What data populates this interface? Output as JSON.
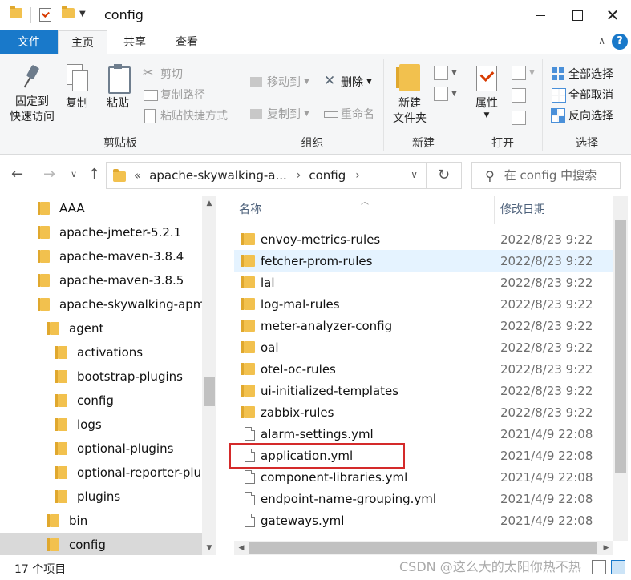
{
  "title": "config",
  "ribbon_tabs": [
    "文件",
    "主页",
    "共享",
    "查看"
  ],
  "ribbon": {
    "clipboard": {
      "label": "剪贴板",
      "pin": "固定到快速访问",
      "pin_l1": "固定到",
      "pin_l2": "快速访问",
      "copy": "复制",
      "paste": "粘贴",
      "cut": "剪切",
      "copy_path": "复制路径",
      "paste_shortcut": "粘贴快捷方式"
    },
    "organize": {
      "label": "组织",
      "move_to": "移动到",
      "copy_to": "复制到",
      "delete": "删除",
      "rename": "重命名"
    },
    "new": {
      "label": "新建",
      "new_folder_l1": "新建",
      "new_folder_l2": "文件夹"
    },
    "open": {
      "label": "打开",
      "properties": "属性"
    },
    "select": {
      "label": "选择",
      "select_all": "全部选择",
      "select_none": "全部取消",
      "invert": "反向选择"
    }
  },
  "address": {
    "overflow": "«",
    "segments": [
      "apache-skywalking-a...",
      "config"
    ],
    "search_placeholder": "在 config 中搜索"
  },
  "tree": [
    {
      "label": "AAA"
    },
    {
      "label": "apache-jmeter-5.2.1"
    },
    {
      "label": "apache-maven-3.8.4"
    },
    {
      "label": "apache-maven-3.8.5"
    },
    {
      "label": "apache-skywalking-apm"
    },
    {
      "label": "agent"
    },
    {
      "label": "activations"
    },
    {
      "label": "bootstrap-plugins"
    },
    {
      "label": "config"
    },
    {
      "label": "logs"
    },
    {
      "label": "optional-plugins"
    },
    {
      "label": "optional-reporter-plu"
    },
    {
      "label": "plugins"
    },
    {
      "label": "bin"
    },
    {
      "label": "config"
    }
  ],
  "columns": {
    "name": "名称",
    "date": "修改日期"
  },
  "files": [
    {
      "name": "envoy-metrics-rules",
      "date": "2022/8/23 9:22",
      "type": "folder"
    },
    {
      "name": "fetcher-prom-rules",
      "date": "2022/8/23 9:22",
      "type": "folder"
    },
    {
      "name": "lal",
      "date": "2022/8/23 9:22",
      "type": "folder"
    },
    {
      "name": "log-mal-rules",
      "date": "2022/8/23 9:22",
      "type": "folder"
    },
    {
      "name": "meter-analyzer-config",
      "date": "2022/8/23 9:22",
      "type": "folder"
    },
    {
      "name": "oal",
      "date": "2022/8/23 9:22",
      "type": "folder"
    },
    {
      "name": "otel-oc-rules",
      "date": "2022/8/23 9:22",
      "type": "folder"
    },
    {
      "name": "ui-initialized-templates",
      "date": "2022/8/23 9:22",
      "type": "folder"
    },
    {
      "name": "zabbix-rules",
      "date": "2022/8/23 9:22",
      "type": "folder"
    },
    {
      "name": "alarm-settings.yml",
      "date": "2021/4/9 22:08",
      "type": "file"
    },
    {
      "name": "application.yml",
      "date": "2021/4/9 22:08",
      "type": "file"
    },
    {
      "name": "component-libraries.yml",
      "date": "2021/4/9 22:08",
      "type": "file"
    },
    {
      "name": "endpoint-name-grouping.yml",
      "date": "2021/4/9 22:08",
      "type": "file"
    },
    {
      "name": "gateways.yml",
      "date": "2021/4/9 22:08",
      "type": "file"
    }
  ],
  "status": {
    "count": "17 个项目"
  },
  "watermark": "CSDN @这么大的太阳你热不热",
  "colors": {
    "accent": "#1979ca",
    "highlight_border": "#d42a2a",
    "hover_row": "#e5f3ff",
    "folder": "#f2c14e"
  }
}
